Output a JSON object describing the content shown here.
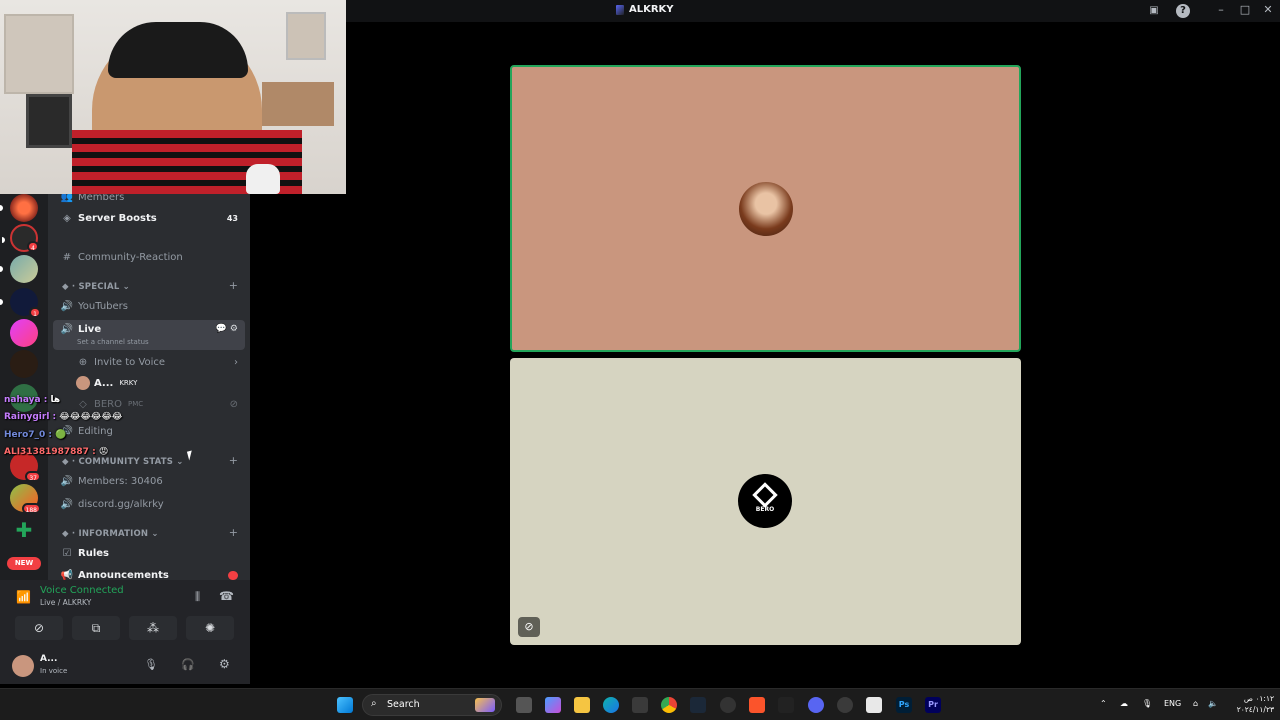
{
  "window": {
    "title": "ALKRKY"
  },
  "sidebar": {
    "members_partial": "Members",
    "server_boosts": {
      "label": "Server Boosts",
      "count": "43"
    },
    "community_reaction": "Community-Reaction",
    "category_special": "SPECIAL",
    "youtubers": "YouTubers",
    "live_channel": "Live",
    "channel_status": "Set a channel status",
    "invite_to_voice": "Invite to Voice",
    "voice_users": [
      {
        "name": "A...",
        "tag": "KRKY"
      },
      {
        "name": "BERO",
        "tag": "PMC"
      }
    ],
    "editing": "Editing",
    "category_stats": "COMMUNITY STATS",
    "members_count": "Members: 30406",
    "discord_link": "discord.gg/alkrky",
    "category_information": "INFORMATION",
    "rules": "Rules",
    "announcements": "Announcements"
  },
  "rail_badges": [
    "4",
    "1",
    "37",
    "188"
  ],
  "rail_new": "NEW",
  "chat_overlay": [
    {
      "user": "nahaya",
      "msg": "ها",
      "color": "#c77dff"
    },
    {
      "user": "Rainygirl",
      "msg": "😂😂😂😂😂😂",
      "color": "#c77dff"
    },
    {
      "user": "Hero7_0",
      "msg": "🟢",
      "color": "#7289da"
    },
    {
      "user": "ALI31381987887",
      "msg": "😡",
      "color": "#ff6b6b"
    }
  ],
  "voice_panel": {
    "status": "Voice Connected",
    "location": "Live / ALKRKY"
  },
  "user_panel": {
    "name": "A...",
    "status": "In voice"
  },
  "call": {
    "tile2_label": "BERO"
  },
  "taskbar": {
    "search_label": "Search",
    "lang": "ENG",
    "time": "٠١:١٢ ص",
    "date": "٢٠٢٤/١١/٢٣"
  }
}
